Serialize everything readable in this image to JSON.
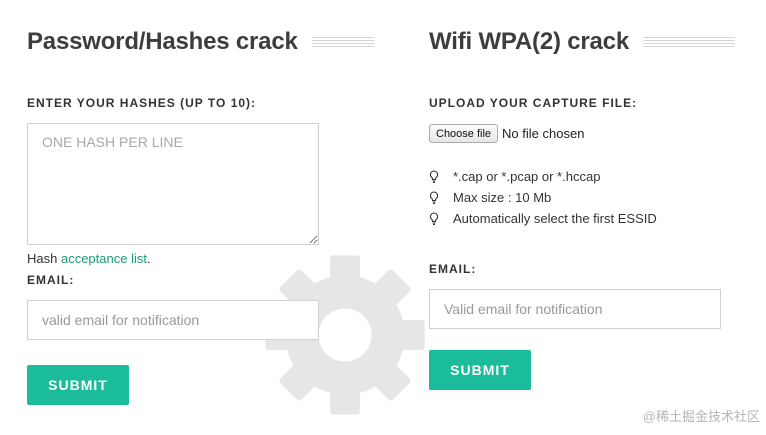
{
  "left": {
    "title": "Password/Hashes crack",
    "hashes_label": "ENTER YOUR HASHES (UP TO 10):",
    "hashes_placeholder": "ONE HASH PER LINE",
    "hash_note_prefix": "Hash ",
    "hash_note_link": "acceptance list",
    "hash_note_suffix": ".",
    "email_label": "EMAIL:",
    "email_placeholder": "valid email for notification",
    "submit_label": "SUBMIT"
  },
  "right": {
    "title": "Wifi WPA(2) crack",
    "upload_label": "UPLOAD YOUR CAPTURE FILE:",
    "choose_file_label": "Choose file",
    "file_status": "No file chosen",
    "tips": [
      {
        "icon": "lightbulb-icon",
        "text": "*.cap or *.pcap or *.hccap"
      },
      {
        "icon": "lightbulb-icon",
        "text": "Max size : 10 Mb"
      },
      {
        "icon": "lightbulb-icon",
        "text": "Automatically select the first ESSID"
      }
    ],
    "email_label": "EMAIL:",
    "email_placeholder": "Valid email for notification",
    "submit_label": "SUBMIT"
  },
  "watermark": "@稀土掘金技术社区",
  "colors": {
    "accent": "#1abc9c",
    "link": "#1a9b7a",
    "gear": "#e6e6e6"
  }
}
